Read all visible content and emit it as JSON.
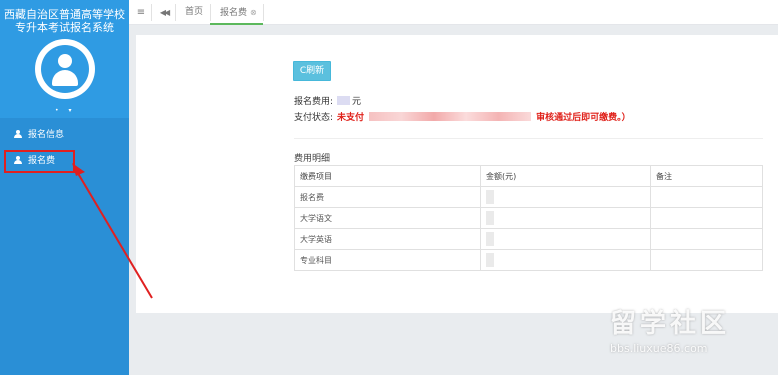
{
  "sidebar": {
    "system_title_line1": "西藏自治区普通高等学校",
    "system_title_line2": "专升本考试报名系统",
    "user_dropdown": "• ▾",
    "items": [
      {
        "label": "报名信息",
        "icon": "user-icon"
      },
      {
        "label": "报名费",
        "icon": "user-icon"
      }
    ]
  },
  "topbar": {
    "menu_icon": "≡",
    "back_icon": "◀◀",
    "tabs": [
      {
        "label": "首页"
      },
      {
        "label": "报名费",
        "close": "⊗"
      }
    ]
  },
  "main": {
    "refresh_label": "C刷新",
    "fee_label": "报名费用:",
    "fee_unit": "元",
    "status_label": "支付状态:",
    "status_text_start": "未支付",
    "status_text_end": "审核通过后即可缴费。）",
    "detail_title": "费用明细",
    "table": {
      "headers": [
        "缴费项目",
        "金额(元)",
        "备注"
      ],
      "rows": [
        {
          "item": "报名费"
        },
        {
          "item": "大学语文"
        },
        {
          "item": "大学英语"
        },
        {
          "item": "专业科目"
        }
      ]
    }
  },
  "watermark": {
    "title": "留学社区",
    "url": "bbs.liuxue86.com"
  },
  "colors": {
    "sidebar": "#2a8fd6",
    "refresh_button": "#5bc0de",
    "status_red": "#e0211a",
    "tab_active": "#5cb85c"
  }
}
